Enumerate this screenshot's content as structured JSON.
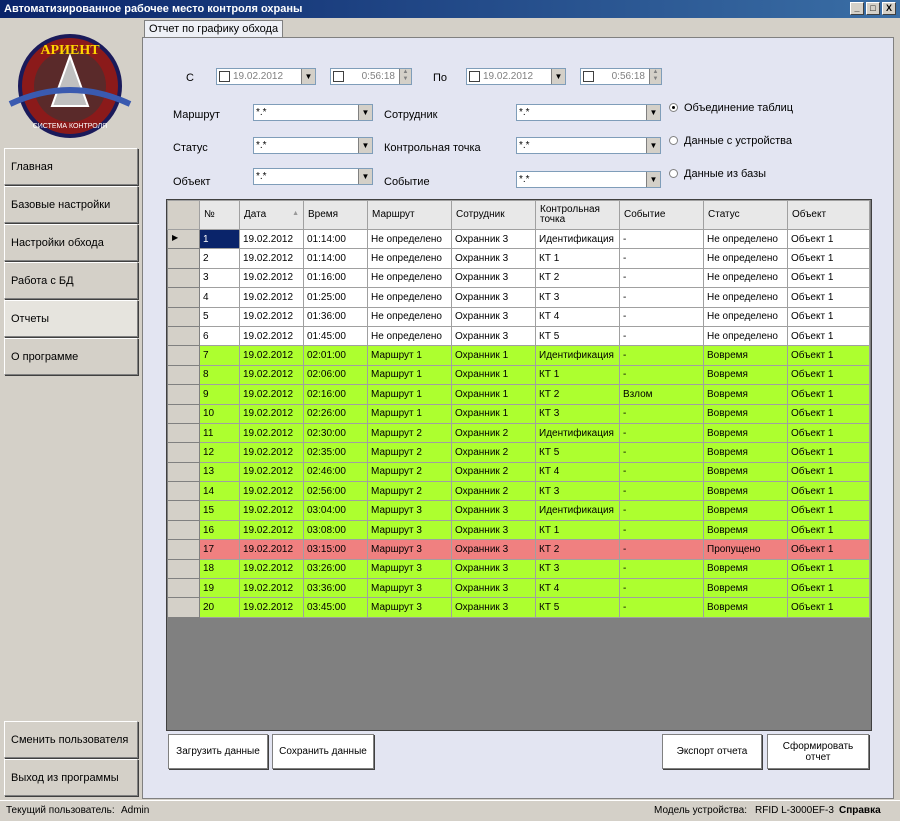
{
  "window": {
    "title": "Автоматизированное рабочее место контроля охраны",
    "min": "_",
    "max": "□",
    "close": "X"
  },
  "logo": {
    "text_top": "АРИЕНТ",
    "text_bottom": "СИСТЕМА КОНТРОЛЯ"
  },
  "sidebar": {
    "items": [
      "Главная",
      "Базовые настройки",
      "Настройки обхода",
      "Работа с БД",
      "Отчеты",
      "О программе"
    ],
    "active_index": 4,
    "bottom_items": [
      "Сменить пользователя",
      "Выход из программы"
    ]
  },
  "tab": {
    "label": "Отчет по графику обхода"
  },
  "filters": {
    "from_label": "С",
    "to_label": "По",
    "from_date": "19.02.2012",
    "from_time": "0:56:18",
    "to_date": "19.02.2012",
    "to_time": "0:56:18",
    "route_label": "Маршрут",
    "route_value": "*.*",
    "status_label": "Статус",
    "status_value": "*.*",
    "object_label": "Объект",
    "object_value": "*.*",
    "employee_label": "Сотрудник",
    "employee_value": "*.*",
    "checkpoint_label": "Контрольная точка",
    "checkpoint_value": "*.*",
    "event_label": "Событие",
    "event_value": "*.*",
    "radio": [
      {
        "label": "Объединение таблиц",
        "checked": true
      },
      {
        "label": "Данные с устройства",
        "checked": false
      },
      {
        "label": "Данные из базы",
        "checked": false
      }
    ]
  },
  "table": {
    "columns": [
      "№",
      "Дата",
      "Время",
      "Маршрут",
      "Сотрудник",
      "Контрольная точка",
      "Событие",
      "Статус",
      "Объект"
    ],
    "sort_indicator": "▲",
    "current_row_marker": "▶",
    "rows": [
      {
        "status": "white",
        "cells": [
          "1",
          "19.02.2012",
          "01:14:00",
          "Не определено",
          "Охранник 3",
          "Идентификация",
          "-",
          "Не определено",
          "Объект 1"
        ]
      },
      {
        "status": "white",
        "cells": [
          "2",
          "19.02.2012",
          "01:14:00",
          "Не определено",
          "Охранник 3",
          "КТ 1",
          "-",
          "Не определено",
          "Объект 1"
        ]
      },
      {
        "status": "white",
        "cells": [
          "3",
          "19.02.2012",
          "01:16:00",
          "Не определено",
          "Охранник 3",
          "КТ 2",
          "-",
          "Не определено",
          "Объект 1"
        ]
      },
      {
        "status": "white",
        "cells": [
          "4",
          "19.02.2012",
          "01:25:00",
          "Не определено",
          "Охранник 3",
          "КТ 3",
          "-",
          "Не определено",
          "Объект 1"
        ]
      },
      {
        "status": "white",
        "cells": [
          "5",
          "19.02.2012",
          "01:36:00",
          "Не определено",
          "Охранник 3",
          "КТ 4",
          "-",
          "Не определено",
          "Объект 1"
        ]
      },
      {
        "status": "white",
        "cells": [
          "6",
          "19.02.2012",
          "01:45:00",
          "Не определено",
          "Охранник 3",
          "КТ 5",
          "-",
          "Не определено",
          "Объект 1"
        ]
      },
      {
        "status": "green",
        "cells": [
          "7",
          "19.02.2012",
          "02:01:00",
          "Маршрут 1",
          "Охранник 1",
          "Идентификация",
          "-",
          "Вовремя",
          "Объект 1"
        ]
      },
      {
        "status": "green",
        "cells": [
          "8",
          "19.02.2012",
          "02:06:00",
          "Маршрут 1",
          "Охранник 1",
          "КТ 1",
          "-",
          "Вовремя",
          "Объект 1"
        ]
      },
      {
        "status": "green",
        "cells": [
          "9",
          "19.02.2012",
          "02:16:00",
          "Маршрут 1",
          "Охранник 1",
          "КТ 2",
          "Взлом",
          "Вовремя",
          "Объект 1"
        ]
      },
      {
        "status": "green",
        "cells": [
          "10",
          "19.02.2012",
          "02:26:00",
          "Маршрут 1",
          "Охранник 1",
          "КТ 3",
          "-",
          "Вовремя",
          "Объект 1"
        ]
      },
      {
        "status": "green",
        "cells": [
          "11",
          "19.02.2012",
          "02:30:00",
          "Маршрут 2",
          "Охранник 2",
          "Идентификация",
          "-",
          "Вовремя",
          "Объект 1"
        ]
      },
      {
        "status": "green",
        "cells": [
          "12",
          "19.02.2012",
          "02:35:00",
          "Маршрут 2",
          "Охранник 2",
          "КТ 5",
          "-",
          "Вовремя",
          "Объект 1"
        ]
      },
      {
        "status": "green",
        "cells": [
          "13",
          "19.02.2012",
          "02:46:00",
          "Маршрут 2",
          "Охранник 2",
          "КТ 4",
          "-",
          "Вовремя",
          "Объект 1"
        ]
      },
      {
        "status": "green",
        "cells": [
          "14",
          "19.02.2012",
          "02:56:00",
          "Маршрут 2",
          "Охранник 2",
          "КТ 3",
          "-",
          "Вовремя",
          "Объект 1"
        ]
      },
      {
        "status": "green",
        "cells": [
          "15",
          "19.02.2012",
          "03:04:00",
          "Маршрут 3",
          "Охранник 3",
          "Идентификация",
          "-",
          "Вовремя",
          "Объект 1"
        ]
      },
      {
        "status": "green",
        "cells": [
          "16",
          "19.02.2012",
          "03:08:00",
          "Маршрут 3",
          "Охранник 3",
          "КТ 1",
          "-",
          "Вовремя",
          "Объект 1"
        ]
      },
      {
        "status": "red",
        "cells": [
          "17",
          "19.02.2012",
          "03:15:00",
          "Маршрут 3",
          "Охранник 3",
          "КТ 2",
          "-",
          "Пропущено",
          "Объект 1"
        ]
      },
      {
        "status": "green",
        "cells": [
          "18",
          "19.02.2012",
          "03:26:00",
          "Маршрут 3",
          "Охранник 3",
          "КТ 3",
          "-",
          "Вовремя",
          "Объект 1"
        ]
      },
      {
        "status": "green",
        "cells": [
          "19",
          "19.02.2012",
          "03:36:00",
          "Маршрут 3",
          "Охранник 3",
          "КТ 4",
          "-",
          "Вовремя",
          "Объект 1"
        ]
      },
      {
        "status": "green",
        "cells": [
          "20",
          "19.02.2012",
          "03:45:00",
          "Маршрут 3",
          "Охранник 3",
          "КТ 5",
          "-",
          "Вовремя",
          "Объект 1"
        ]
      }
    ]
  },
  "buttons": {
    "load": "Загрузить данные",
    "save": "Сохранить данные",
    "export": "Экспорт отчета",
    "generate": "Сформировать отчет"
  },
  "statusbar": {
    "user_label": "Текущий пользователь:",
    "user_value": "Admin",
    "device_label": "Модель устройства:",
    "device_value": "RFID L-3000EF-3",
    "help": "Справка"
  },
  "colors": {
    "green_row": "#adff2f",
    "red_row": "#f08080",
    "title_bar": "#0a246a"
  }
}
